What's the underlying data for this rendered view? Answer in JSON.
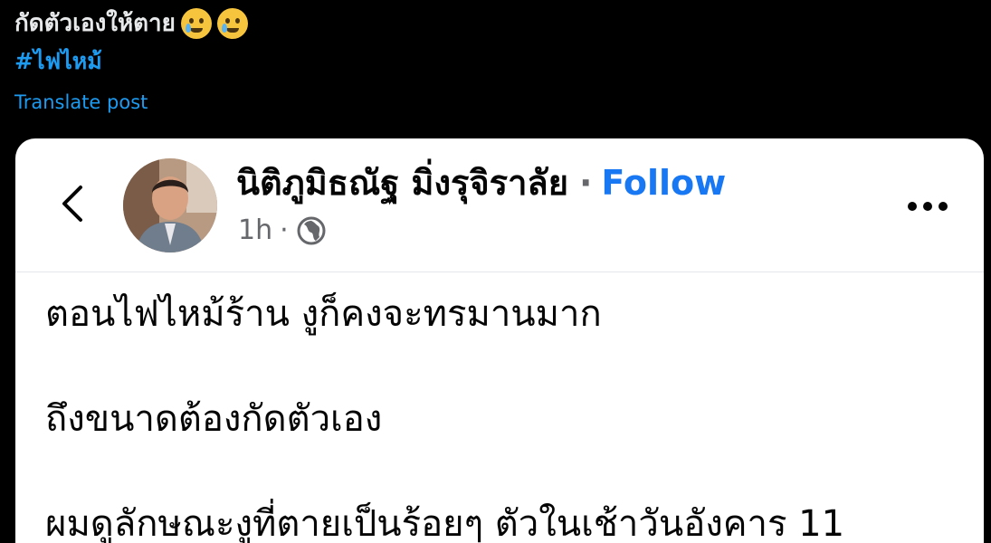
{
  "tweet": {
    "text": "กัดตัวเองให้ตาย",
    "emojis": [
      "crying-face",
      "crying-face"
    ],
    "hashtag": "#ไฟไหม้",
    "translate_label": "Translate post"
  },
  "embedded_post": {
    "author_name": "นิติภูมิธณัฐ มิ่งรุจิราลัย",
    "separator": "·",
    "follow_label": "Follow",
    "time": "1h",
    "separator_small": "·",
    "privacy_icon": "globe-icon",
    "more_icon": "more-options-icon",
    "back_icon": "back-arrow-icon",
    "body_lines": [
      "ตอนไฟไหม้ร้าน งูก็คงจะทรมานมาก",
      "ถึงขนาดต้องกัดตัวเอง",
      "ผมดูลักษณะงูที่ตายเป็นร้อยๆ ตัวในเช้าวันอังคาร 11"
    ]
  },
  "colors": {
    "background": "#000000",
    "tweet_text": "#e7e9ea",
    "link_blue": "#1d9bf0",
    "facebook_blue": "#1877f2",
    "card_background": "#ffffff",
    "secondary_text": "#65676b"
  }
}
